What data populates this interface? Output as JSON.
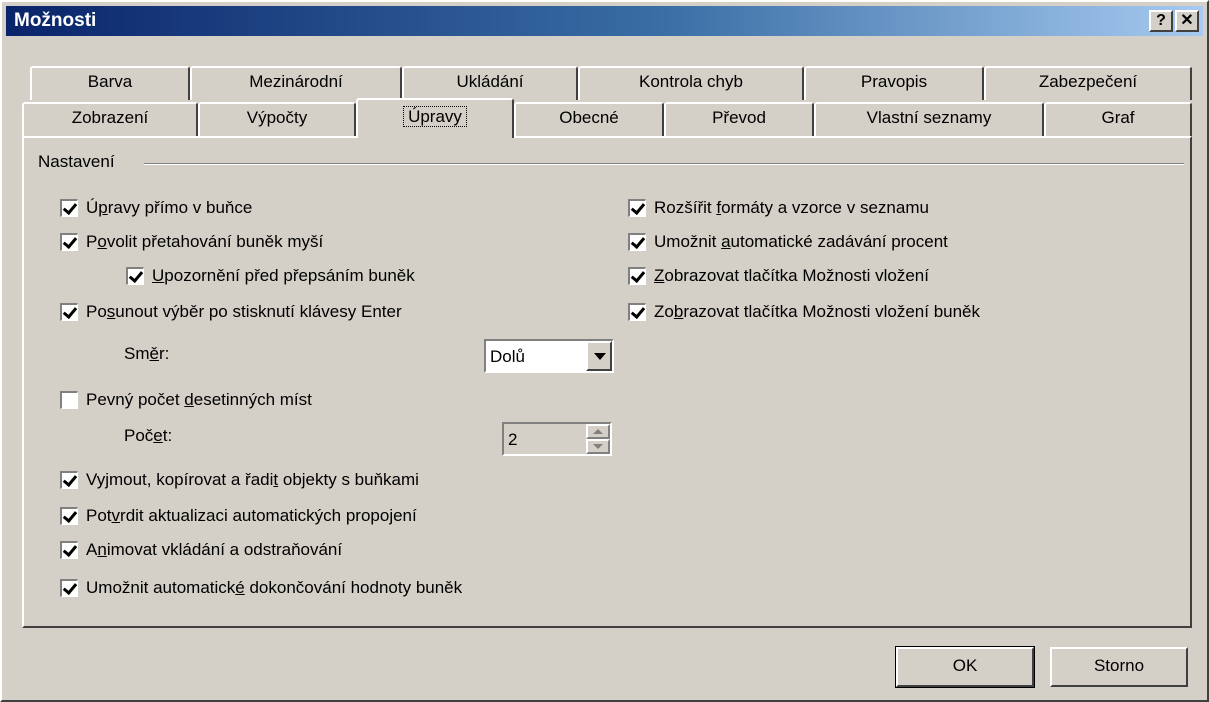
{
  "window": {
    "title": "Možnosti",
    "help_button": "?",
    "close_button": "✕"
  },
  "tabs_row1": [
    "Barva",
    "Mezinárodní",
    "Ukládání",
    "Kontrola chyb",
    "Pravopis",
    "Zabezpečení"
  ],
  "tabs_row2": [
    "Zobrazení",
    "Výpočty",
    "Úpravy",
    "Obecné",
    "Převod",
    "Vlastní seznamy",
    "Graf"
  ],
  "active_tab": "Úpravy",
  "group": {
    "label": "Nastavení"
  },
  "left_options": [
    {
      "pre": "Ú",
      "u": "p",
      "post": "ravy přímo v buňce",
      "checked": true
    },
    {
      "pre": "P",
      "u": "o",
      "post": "volit přetahování buněk myší",
      "checked": true
    },
    {
      "pre": "",
      "u": "U",
      "post": "pozornění před přepsáním buněk",
      "checked": true
    },
    {
      "pre": "Po",
      "u": "s",
      "post": "unout výběr po stisknutí klávesy Enter",
      "checked": true
    },
    {
      "pre": "Pevný počet ",
      "u": "d",
      "post": "esetinných míst",
      "checked": false
    },
    {
      "pre": "Vyjmout, kopírovat a řadi",
      "u": "t",
      "post": " objekty s buňkami",
      "checked": true
    },
    {
      "pre": "Pot",
      "u": "v",
      "post": "rdit aktualizaci automatických propojení",
      "checked": true
    },
    {
      "pre": "A",
      "u": "n",
      "post": "imovat vkládání a odstraňování",
      "checked": true
    },
    {
      "pre": "Umožnit automatick",
      "u": "é",
      "post": " dokončování hodnoty buněk",
      "checked": true
    }
  ],
  "right_options": [
    {
      "pre": "Rozšířit ",
      "u": "f",
      "post": "ormáty a vzorce v seznamu",
      "checked": true
    },
    {
      "pre": "Umožnit ",
      "u": "a",
      "post": "utomatické zadávání procent",
      "checked": true
    },
    {
      "pre": "",
      "u": "Z",
      "post": "obrazovat tlačítka Možnosti vložení",
      "checked": true
    },
    {
      "pre": "Zo",
      "u": "b",
      "post": "razovat tlačítka Možnosti vložení buněk",
      "checked": true
    }
  ],
  "direction": {
    "pre": "Sm",
    "u": "ě",
    "post": "r:",
    "value": "Dolů"
  },
  "count": {
    "pre": "Poč",
    "u": "e",
    "post": "t:",
    "value": "2"
  },
  "buttons": {
    "ok": "OK",
    "cancel": "Storno"
  }
}
